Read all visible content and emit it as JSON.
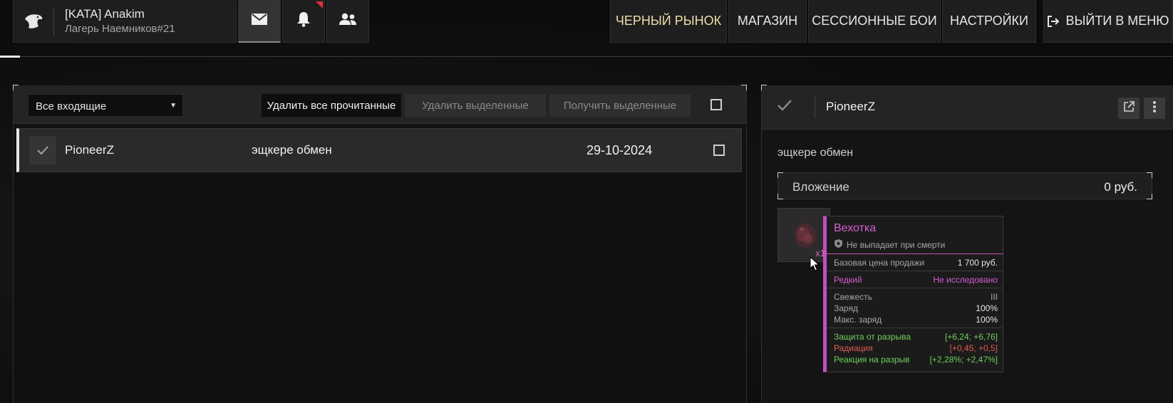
{
  "profile": {
    "name": "[KATA] Anakim",
    "camp": "Лагерь Наемников#21"
  },
  "icons": {
    "logo": "eagle-logo-icon",
    "mail": "envelope-icon",
    "notifications": "bell-icon",
    "friends": "users-icon",
    "exit": "exit-icon"
  },
  "nav": {
    "black_market": "ЧЕРНЫЙ РЫНОК",
    "shop": "МАГАЗИН",
    "session_battles": "СЕССИОННЫЕ БОИ",
    "settings": "НАСТРОЙКИ",
    "exit_menu": "ВЫЙТИ В МЕНЮ"
  },
  "inbox": {
    "filter": "Все входящие",
    "delete_read": "Удалить все прочитанные",
    "delete_selected": "Удалить выделенные",
    "receive_selected": "Получить выделенные",
    "messages": [
      {
        "sender": "PioneerZ",
        "subject": "эщкере обмен",
        "date": "29-10-2024"
      }
    ]
  },
  "detail": {
    "sender": "PioneerZ",
    "subject": "эщкере обмен",
    "attachment_label": "Вложение",
    "attachment_value": "0 руб.",
    "item_count": "x1"
  },
  "tooltip": {
    "title": "Вехотка",
    "no_drop": "Не выпадает при смерти",
    "base_price_label": "Базовая цена продажи",
    "base_price_value": "1 700 руб.",
    "rarity": "Редкий",
    "research": "Не исследовано",
    "freshness_label": "Свежесть",
    "freshness_value": "III",
    "charge_label": "Заряд",
    "charge_value": "100%",
    "max_charge_label": "Макс. заряд",
    "max_charge_value": "100%",
    "stats": [
      {
        "label": "Защита от разрыва",
        "value": "[+6,24; +6,76]",
        "color": "#6fcf5b"
      },
      {
        "label": "Радиация",
        "value": "[+0,45; +0,5]",
        "color": "#e05a55"
      },
      {
        "label": "Реакция на разрыв",
        "value": "[+2,28%; +2,47%]",
        "color": "#6fcf5b"
      }
    ]
  }
}
